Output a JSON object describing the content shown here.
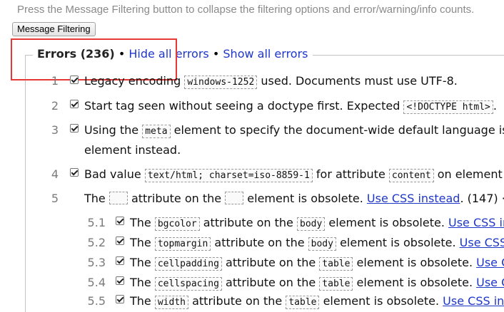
{
  "hint": "Press the Message Filtering button to collapse the filtering options and error/warning/info counts.",
  "message_filtering_button": "Message Filtering",
  "errors_header": {
    "title": "Errors (236)",
    "separator": "•",
    "hide_all": "Hide all errors",
    "show_all": "Show all errors"
  },
  "messages": [
    {
      "num": "1",
      "t1": "Legacy encoding",
      "c1": "windows-1252",
      "t2": "used. Documents must use UTF-8."
    },
    {
      "num": "2",
      "t1": "Start tag seen without seeing a doctype first. Expected",
      "c1": "<!DOCTYPE html>",
      "t2": "."
    },
    {
      "num": "3",
      "t1": "Using the",
      "c1": "meta",
      "t2": "element to specify the document-wide default language is o",
      "line2": "element instead."
    },
    {
      "num": "4",
      "t1": "Bad value",
      "c1": "text/html; charset=iso-8859-1",
      "t2": "for attribute",
      "c2": "content",
      "t3": "on element"
    },
    {
      "num": "5",
      "t1": "The",
      "t2": "attribute on the",
      "t3": "element is obsolete.",
      "link": "Use CSS instead",
      "count": ". (147) ·",
      "link2": "H"
    }
  ],
  "submessages": [
    {
      "num": "5.1",
      "attr": "bgcolor",
      "el": "body",
      "link": "Use CSS ins"
    },
    {
      "num": "5.2",
      "attr": "topmargin",
      "el": "body",
      "link": "Use CSS in"
    },
    {
      "num": "5.3",
      "attr": "cellpadding",
      "el": "table",
      "link": "Use CS"
    },
    {
      "num": "5.4",
      "attr": "cellspacing",
      "el": "table",
      "link": "Use CS"
    },
    {
      "num": "5.5",
      "attr": "width",
      "el": "table",
      "link": "Use CSS inst"
    }
  ],
  "sub_text": {
    "the": "The",
    "attr_on": "attribute on the",
    "obsolete": "element is obsolete."
  }
}
